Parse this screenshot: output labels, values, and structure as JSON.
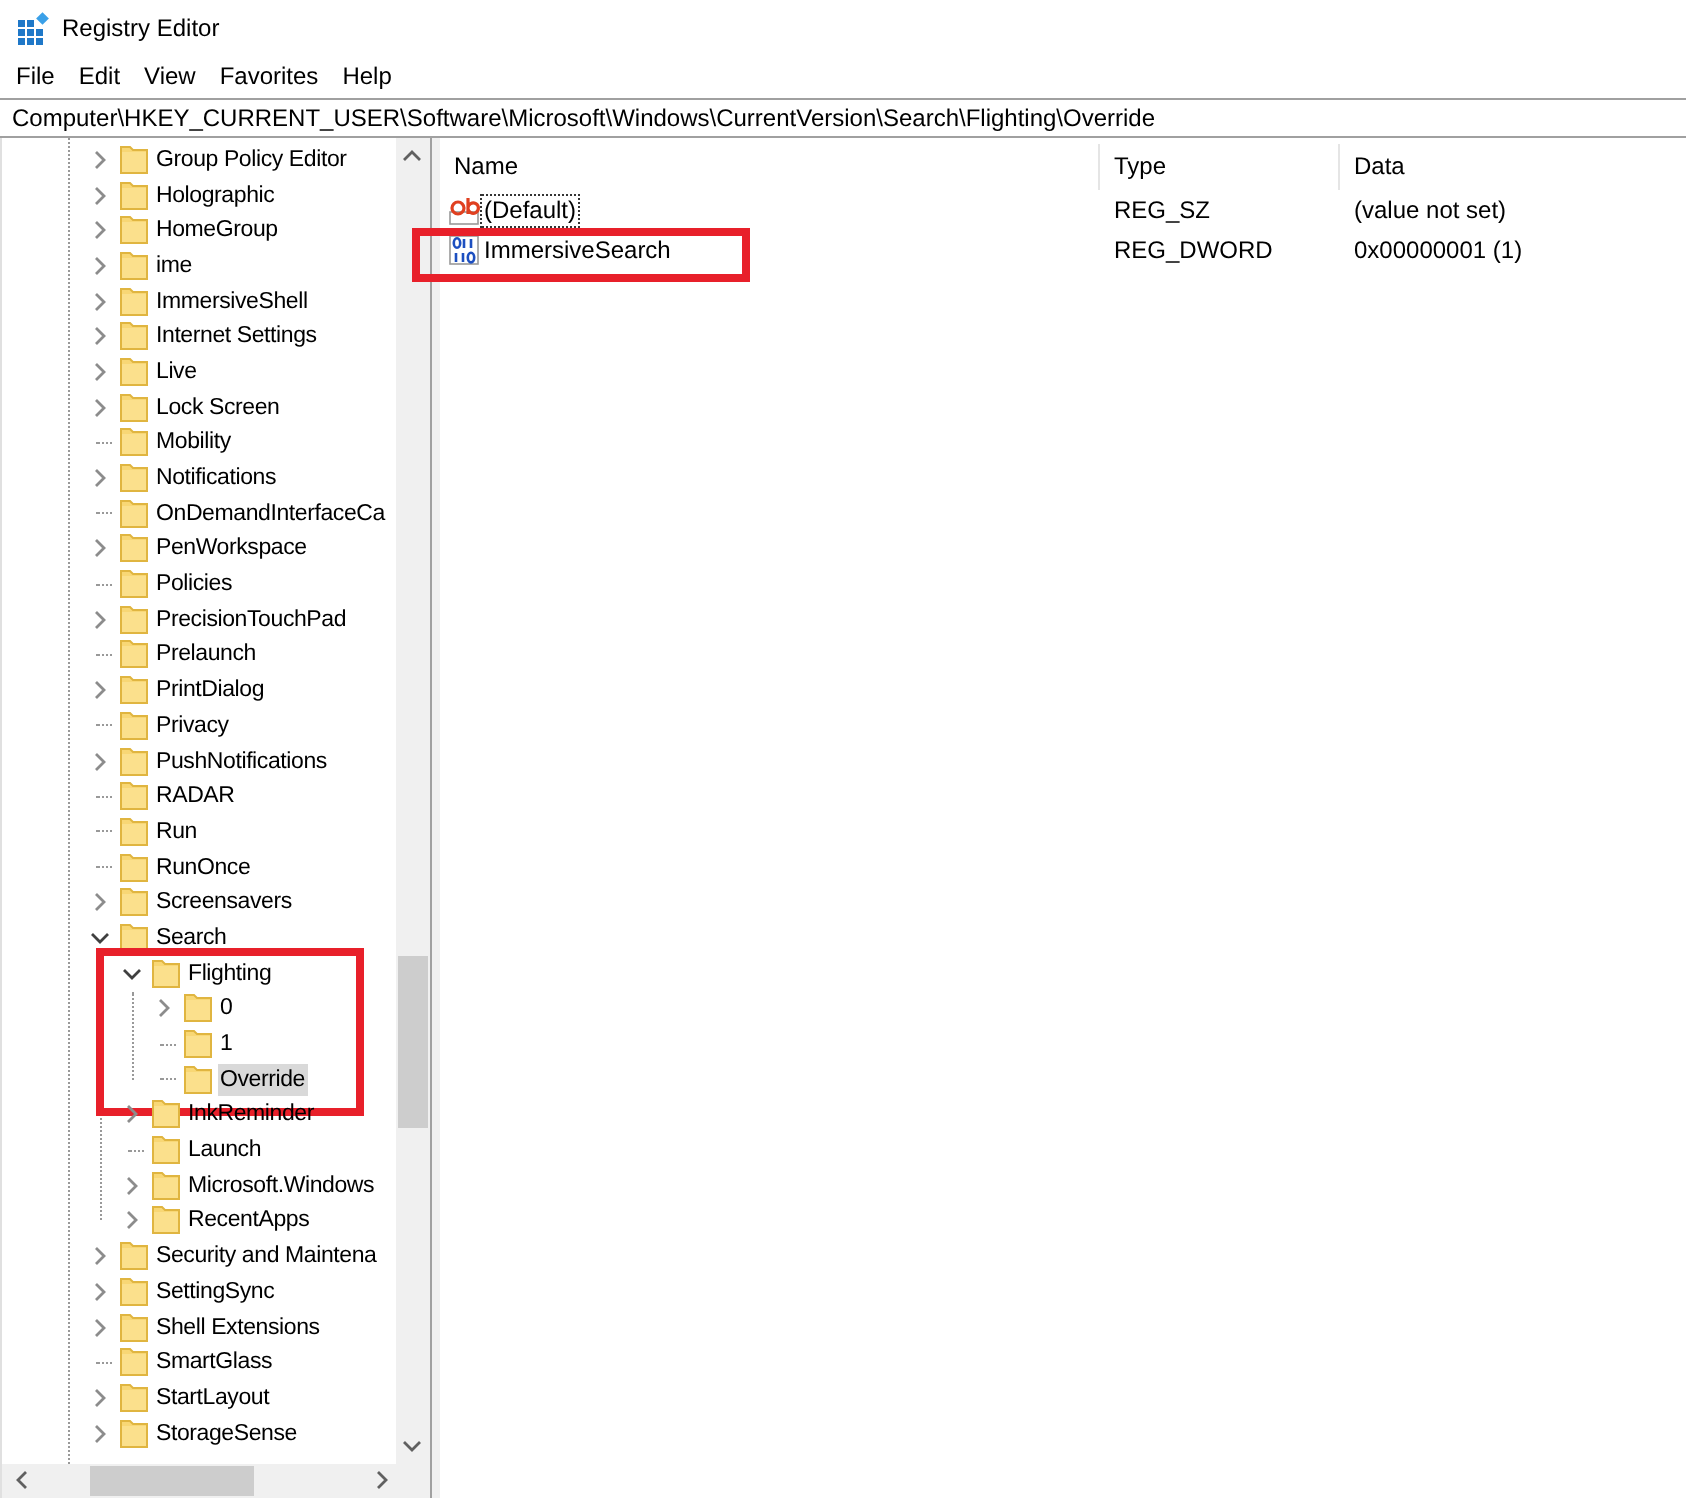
{
  "window": {
    "title": "Registry Editor"
  },
  "menu": [
    {
      "label": "File"
    },
    {
      "label": "Edit"
    },
    {
      "label": "View"
    },
    {
      "label": "Favorites"
    },
    {
      "label": "Help"
    }
  ],
  "address": "Computer\\HKEY_CURRENT_USER\\Software\\Microsoft\\Windows\\CurrentVersion\\Search\\Flighting\\Override",
  "tree": {
    "items": [
      {
        "label": "Group Policy Editor",
        "has_children": true,
        "expanded": false,
        "selected": false
      },
      {
        "label": "Holographic",
        "has_children": true,
        "expanded": false,
        "selected": false
      },
      {
        "label": "HomeGroup",
        "has_children": true,
        "expanded": false,
        "selected": false
      },
      {
        "label": "ime",
        "has_children": true,
        "expanded": false,
        "selected": false
      },
      {
        "label": "ImmersiveShell",
        "has_children": true,
        "expanded": false,
        "selected": false
      },
      {
        "label": "Internet Settings",
        "has_children": true,
        "expanded": false,
        "selected": false
      },
      {
        "label": "Live",
        "has_children": true,
        "expanded": false,
        "selected": false
      },
      {
        "label": "Lock Screen",
        "has_children": true,
        "expanded": false,
        "selected": false
      },
      {
        "label": "Mobility",
        "has_children": false,
        "selected": false
      },
      {
        "label": "Notifications",
        "has_children": true,
        "expanded": false,
        "selected": false
      },
      {
        "label": "OnDemandInterfaceCa",
        "has_children": false,
        "selected": false
      },
      {
        "label": "PenWorkspace",
        "has_children": true,
        "expanded": false,
        "selected": false
      },
      {
        "label": "Policies",
        "has_children": false,
        "selected": false
      },
      {
        "label": "PrecisionTouchPad",
        "has_children": true,
        "expanded": false,
        "selected": false
      },
      {
        "label": "Prelaunch",
        "has_children": false,
        "selected": false
      },
      {
        "label": "PrintDialog",
        "has_children": true,
        "expanded": false,
        "selected": false
      },
      {
        "label": "Privacy",
        "has_children": false,
        "selected": false
      },
      {
        "label": "PushNotifications",
        "has_children": true,
        "expanded": false,
        "selected": false
      },
      {
        "label": "RADAR",
        "has_children": false,
        "selected": false
      },
      {
        "label": "Run",
        "has_children": false,
        "selected": false
      },
      {
        "label": "RunOnce",
        "has_children": false,
        "selected": false
      },
      {
        "label": "Screensavers",
        "has_children": true,
        "expanded": false,
        "selected": false
      },
      {
        "label": "Search",
        "has_children": true,
        "expanded": true,
        "selected": false,
        "children": [
          {
            "label": "Flighting",
            "has_children": true,
            "expanded": true,
            "selected": false,
            "highlighted": true,
            "children": [
              {
                "label": "0",
                "has_children": true,
                "expanded": false,
                "selected": false
              },
              {
                "label": "1",
                "has_children": false,
                "selected": false
              },
              {
                "label": "Override",
                "has_children": false,
                "selected": true
              }
            ]
          },
          {
            "label": "InkReminder",
            "has_children": true,
            "expanded": false,
            "selected": false
          },
          {
            "label": "Launch",
            "has_children": false,
            "selected": false
          },
          {
            "label": "Microsoft.Windows",
            "has_children": true,
            "expanded": false,
            "selected": false
          },
          {
            "label": "RecentApps",
            "has_children": true,
            "expanded": false,
            "selected": false
          }
        ]
      },
      {
        "label": "Security and Maintena",
        "has_children": true,
        "expanded": false,
        "selected": false
      },
      {
        "label": "SettingSync",
        "has_children": true,
        "expanded": false,
        "selected": false
      },
      {
        "label": "Shell Extensions",
        "has_children": true,
        "expanded": false,
        "selected": false
      },
      {
        "label": "SmartGlass",
        "has_children": false,
        "selected": false
      },
      {
        "label": "StartLayout",
        "has_children": true,
        "expanded": false,
        "selected": false
      },
      {
        "label": "StorageSense",
        "has_children": true,
        "expanded": false,
        "selected": false
      }
    ]
  },
  "values": {
    "columns": [
      "Name",
      "Type",
      "Data"
    ],
    "rows": [
      {
        "kind": "string",
        "name": "(Default)",
        "type": "REG_SZ",
        "data": "(value not set)",
        "focused": true,
        "highlighted": false
      },
      {
        "kind": "dword",
        "name": "ImmersiveSearch",
        "type": "REG_DWORD",
        "data": "0x00000001 (1)",
        "focused": false,
        "highlighted": true
      }
    ]
  }
}
